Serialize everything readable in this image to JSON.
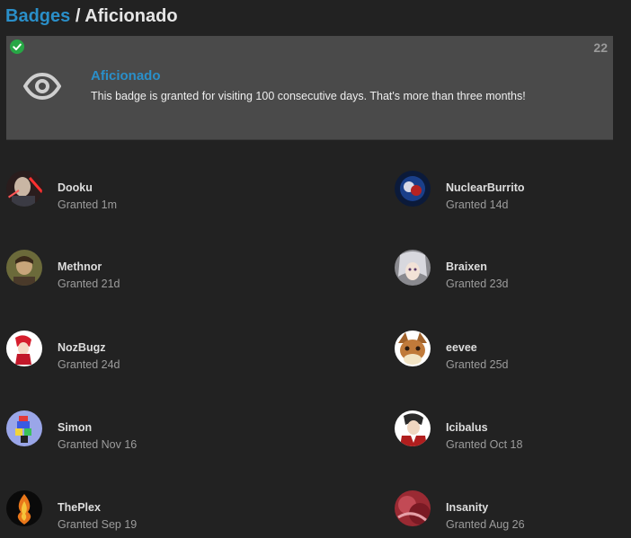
{
  "breadcrumb": {
    "parent": "Badges",
    "separator": "/",
    "current": "Aficionado"
  },
  "badge": {
    "icon": "eye-icon",
    "title": "Aficionado",
    "description": "This badge is granted for visiting 100 consecutive days. That's more than three months!",
    "count": "22",
    "granted_icon": "check-circle-icon"
  },
  "grants": [
    {
      "name": "Dooku",
      "time": "Granted 1m"
    },
    {
      "name": "NuclearBurrito",
      "time": "Granted 14d"
    },
    {
      "name": "Methnor",
      "time": "Granted 21d"
    },
    {
      "name": "Braixen",
      "time": "Granted 23d"
    },
    {
      "name": "NozBugz",
      "time": "Granted 24d"
    },
    {
      "name": "eevee",
      "time": "Granted 25d"
    },
    {
      "name": "Simon",
      "time": "Granted Nov 16"
    },
    {
      "name": "Icibalus",
      "time": "Granted Oct 18"
    },
    {
      "name": "ThePlex",
      "time": "Granted Sep 19"
    },
    {
      "name": "Insanity",
      "time": "Granted Aug 26"
    }
  ],
  "colors": {
    "background": "#222222",
    "card": "#4a4a4a",
    "link": "#2a8fc9",
    "check": "#27a745"
  }
}
